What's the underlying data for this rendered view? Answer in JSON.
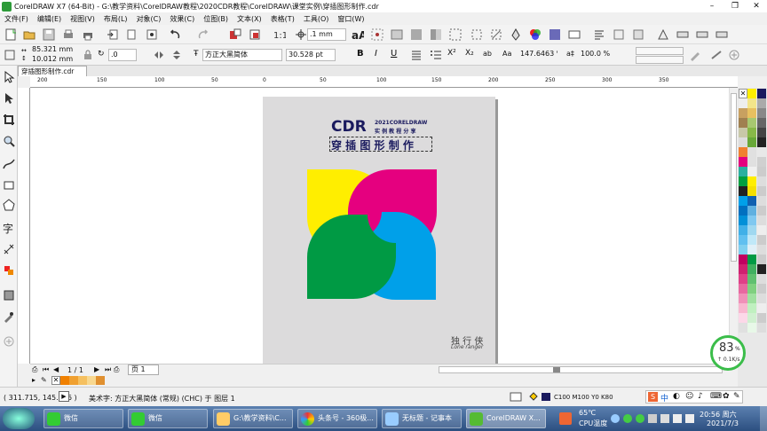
{
  "window": {
    "title": "CorelDRAW X7 (64-Bit) - G:\\教学资料\\CorelDRAW教程\\2020CDR教程\\CorelDRAW\\课堂实例\\穿插图形制作.cdr"
  },
  "menu": [
    "文件(F)",
    "编辑(E)",
    "视图(V)",
    "布局(L)",
    "对象(C)",
    "效果(C)",
    "位图(B)",
    "文本(X)",
    "表格(T)",
    "工具(O)",
    "窗口(W)"
  ],
  "toolbar": {
    "nudge": ".1 mm"
  },
  "propbar": {
    "width": "85.321 mm",
    "height": "10.012 mm",
    "angle": ".0",
    "font_name": "方正大黑简体",
    "font_size": "30.528 pt",
    "char_scale": "147.6463 %",
    "line_scale": "100.0 %"
  },
  "doc_tab": "穿插图形制作.cdr",
  "ruler_labels": [
    "200",
    "150",
    "100",
    "50",
    "0",
    "50",
    "100",
    "150",
    "200",
    "250",
    "300",
    "350"
  ],
  "artwork": {
    "title": "CDR",
    "sub1": "2021CORELDRAW",
    "sub2": "实 例 教 程 分 享",
    "heading": "穿 插 图 形 制 作",
    "sig1": "独 行 侠",
    "sig2": "Lone ranger",
    "colors": {
      "yellow": "#ffee00",
      "magenta": "#e5007f",
      "cyan": "#00a0e9",
      "green": "#009a44",
      "navy": "#1a1a5e"
    }
  },
  "pager": {
    "current": "1 / 1",
    "tab": "页 1"
  },
  "status": {
    "coords": "( 311.715, 145.236 )",
    "info": "美术字: 方正大黑简体 (常规) (CHC) 于 图层 1",
    "fill": "C100 M100 Y0 K80"
  },
  "net": {
    "percent": "83",
    "unit": "%",
    "speed": "↑ 0.1K/s"
  },
  "taskbar": {
    "items": [
      "微信",
      "微信",
      "G:\\教学资料\\C...",
      "头条号 - 360极...",
      "无标题 - 记事本",
      "CorelDRAW X..."
    ],
    "temp": "65℃",
    "cpu": "CPU温度",
    "time": "20:56 周六",
    "date": "2021/7/3"
  }
}
